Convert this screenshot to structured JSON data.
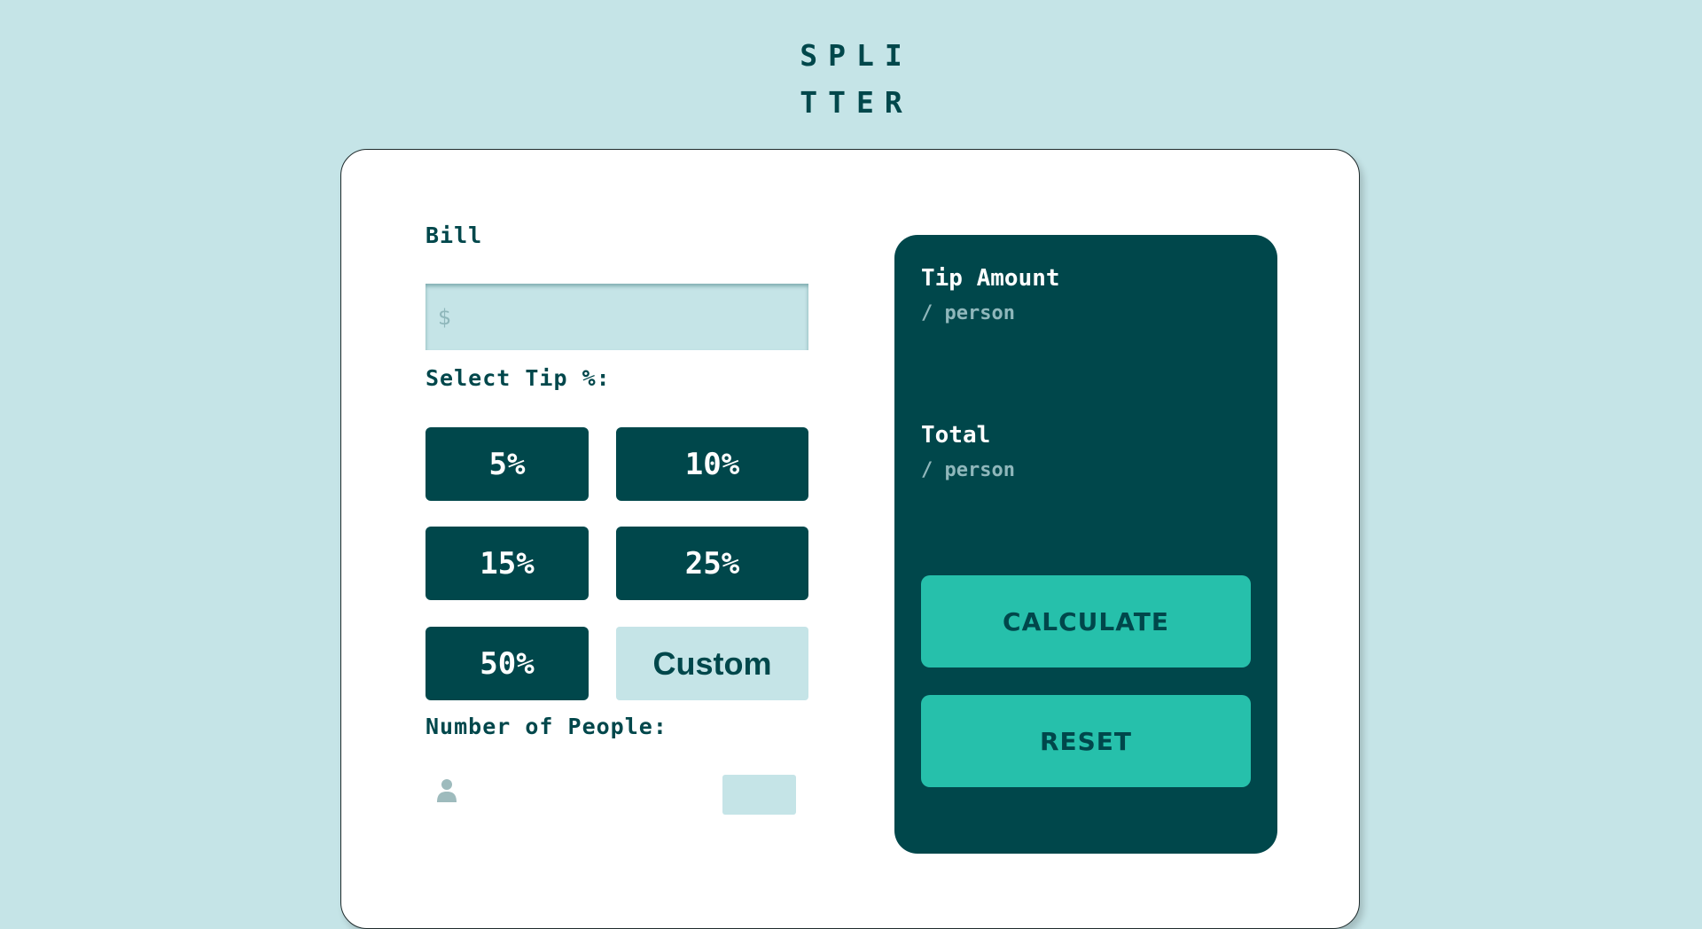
{
  "app": {
    "logo_line1": "SPLI",
    "logo_line2": "TTER"
  },
  "form": {
    "bill_label": "Bill",
    "bill_placeholder": "$",
    "tip_label": "Select Tip %:",
    "tip_options": [
      "5%",
      "10%",
      "15%",
      "25%",
      "50%"
    ],
    "custom_label": "Custom",
    "people_label": "Number of People:",
    "people_icon": "person-icon"
  },
  "results": {
    "tip_title": "Tip Amount",
    "tip_sub": "/ person",
    "total_title": "Total",
    "total_sub": "/ person",
    "calculate_label": "CALCULATE",
    "reset_label": "RESET"
  },
  "colors": {
    "background": "#c5e4e7",
    "dark_teal": "#00474b",
    "accent": "#26c0ab",
    "muted": "#8fb7bb"
  }
}
